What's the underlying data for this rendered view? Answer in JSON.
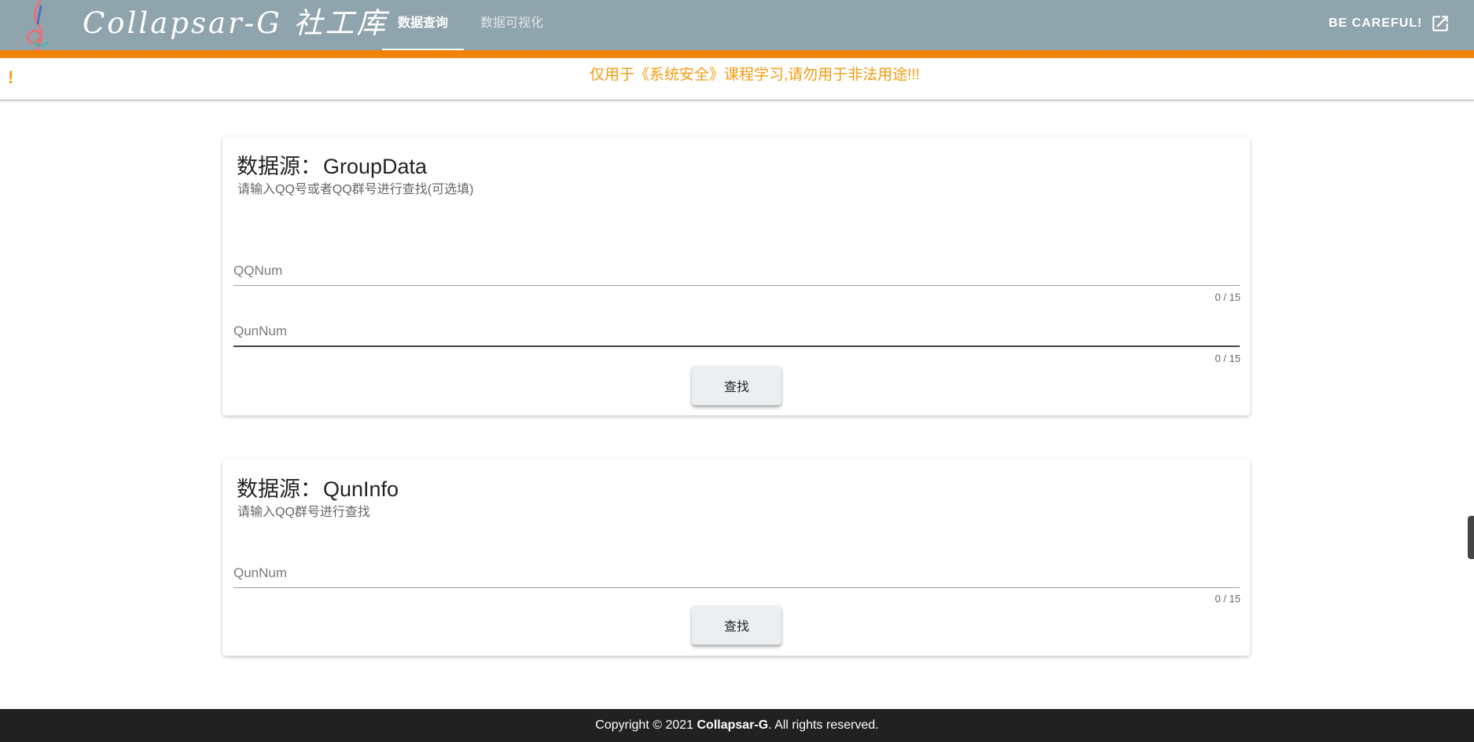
{
  "header": {
    "app_title": "Collapsar-G 社工库",
    "nav_tabs": [
      {
        "label": "数据查询",
        "active": true
      },
      {
        "label": "数据可视化",
        "active": false
      }
    ],
    "action_label": "BE CAREFUL!",
    "action_icon": "open-in-new-icon",
    "logo_icon": "treble-clef-icon",
    "bar_color": "#90a4ae",
    "stripe_color": "#f57c00"
  },
  "alert": {
    "icon": "exclamation-icon",
    "icon_text": "!",
    "text": "仅用于《系统安全》课程学习,请勿用于非法用途!!!",
    "color": "#f39c12"
  },
  "cards": [
    {
      "title": "数据源：",
      "source": "GroupData",
      "subtitle": "请输入QQ号或者QQ群号进行查找(可选填)",
      "fields": [
        {
          "placeholder": "QQNum",
          "value": "",
          "counter": "0 / 15"
        },
        {
          "placeholder": "QunNum",
          "value": "",
          "counter": "0 / 15"
        }
      ],
      "button_label": "查找"
    },
    {
      "title": "数据源：",
      "source": "QunInfo",
      "subtitle": "请输入QQ群号进行查找",
      "fields": [
        {
          "placeholder": "QunNum",
          "value": "",
          "counter": "0 / 15"
        }
      ],
      "button_label": "查找"
    }
  ],
  "footer": {
    "prefix": "Copyright © 2021 ",
    "brand": "Collapsar-G",
    "suffix": ". All rights reserved.",
    "color": "#212121"
  }
}
